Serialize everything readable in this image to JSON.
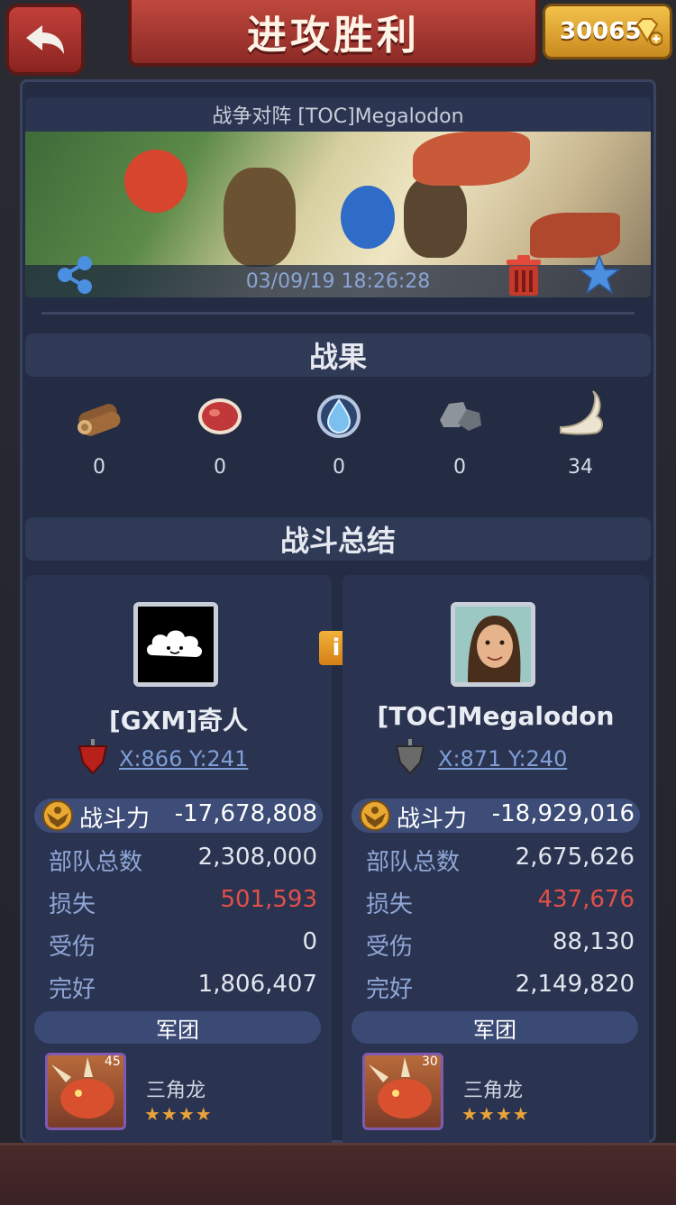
{
  "header": {
    "title": "进攻胜利",
    "gems": "30065"
  },
  "battle": {
    "title": "战争对阵 [TOC]Megalodon",
    "date": "03/09/19 18:26:28"
  },
  "sections": {
    "results": "战果",
    "summary": "战斗总结"
  },
  "resources": [
    {
      "icon": "wood-icon",
      "value": "0"
    },
    {
      "icon": "meat-icon",
      "value": "0"
    },
    {
      "icon": "crystal-icon",
      "value": "0"
    },
    {
      "icon": "stone-icon",
      "value": "0"
    },
    {
      "icon": "bone-icon",
      "value": "34"
    }
  ],
  "left": {
    "name": "[GXM]奇人",
    "coord": "X:866 Y:241",
    "power_label": "战斗力",
    "power": "-17,678,808",
    "stats": [
      {
        "k": "部队总数",
        "v": "2,308,000"
      },
      {
        "k": "损失",
        "v": "501,593"
      },
      {
        "k": "受伤",
        "v": "0"
      },
      {
        "k": "完好",
        "v": "1,806,407"
      }
    ],
    "legion": "军团",
    "unit": {
      "name": "三角龙",
      "level": "45",
      "stars": "★★★★"
    }
  },
  "right": {
    "name": "[TOC]Megalodon",
    "coord": "X:871 Y:240",
    "power_label": "战斗力",
    "power": "-18,929,016",
    "stats": [
      {
        "k": "部队总数",
        "v": "2,675,626"
      },
      {
        "k": "损失",
        "v": "437,676"
      },
      {
        "k": "受伤",
        "v": "88,130"
      },
      {
        "k": "完好",
        "v": "2,149,820"
      }
    ],
    "legion": "军团",
    "unit": {
      "name": "三角龙",
      "level": "30",
      "stars": "★★★★"
    }
  },
  "info_label": "i",
  "colors": {
    "loss": "#e2504a",
    "accent": "#c0483e",
    "gold": "#f3c24a"
  }
}
